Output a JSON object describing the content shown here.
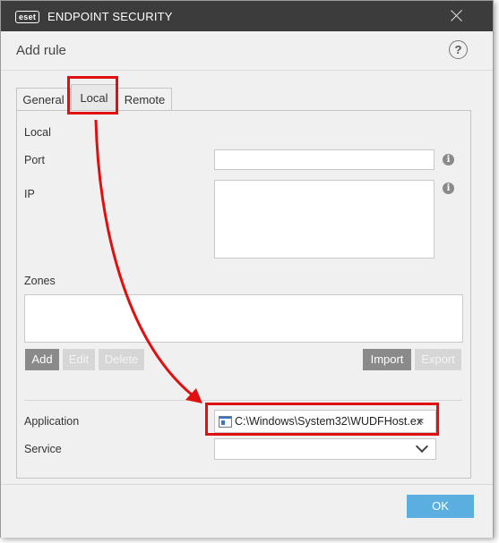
{
  "window": {
    "logo_text": "eset",
    "product_name": "ENDPOINT SECURITY",
    "close_icon": "close-icon"
  },
  "header": {
    "title": "Add rule",
    "help_glyph": "?"
  },
  "tabs": [
    {
      "label": "General",
      "active": false
    },
    {
      "label": "Local",
      "active": true
    },
    {
      "label": "Remote",
      "active": false
    }
  ],
  "local": {
    "section_title": "Local",
    "port_label": "Port",
    "port_value": "",
    "ip_label": "IP",
    "ip_value": "",
    "zones_label": "Zones",
    "info_glyph": "i",
    "buttons": {
      "add": "Add",
      "edit": "Edit",
      "delete": "Delete",
      "import": "Import",
      "export": "Export"
    },
    "application_label": "Application",
    "application_value": "C:\\Windows\\System32\\WUDFHost.ex",
    "clear_glyph": "×",
    "service_label": "Service",
    "service_value": ""
  },
  "footer": {
    "ok_label": "OK"
  },
  "colors": {
    "titlebar": "#3c3c3c",
    "ok_button": "#5aaee0",
    "highlight": "#e01010",
    "enabled_button": "#8a8a8a",
    "disabled_button": "#d6d6d6"
  }
}
